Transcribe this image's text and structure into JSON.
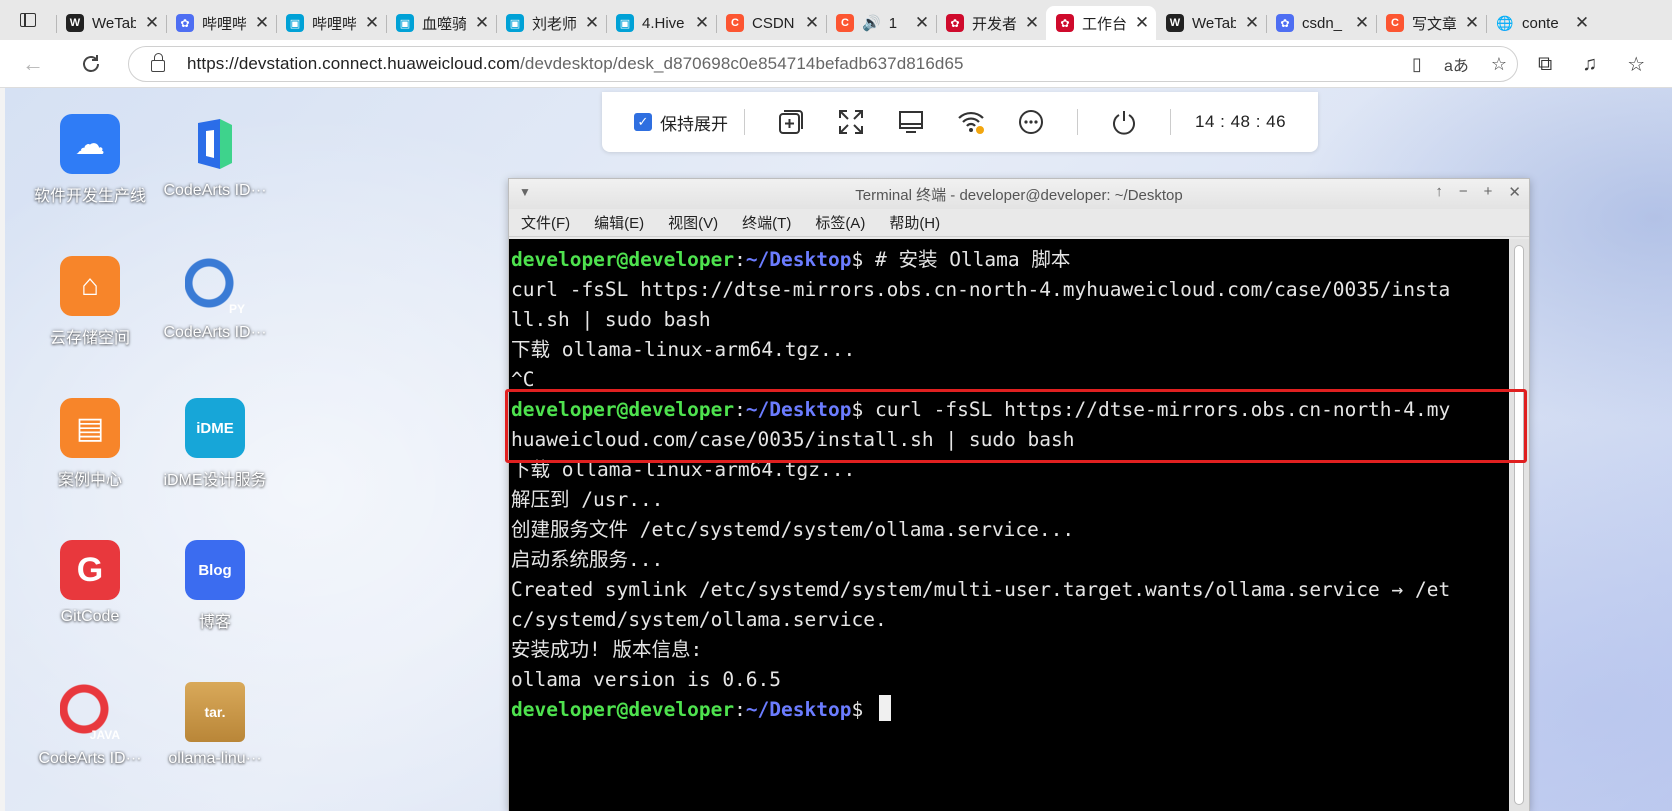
{
  "browser": {
    "tabs": [
      {
        "title": "WeTab",
        "icon": "wetab-icon",
        "color": "#222222",
        "glyph": "W"
      },
      {
        "title": "哔哩哔哩",
        "icon": "baidu-paw-icon",
        "color": "#4e6ef2",
        "glyph": "✿"
      },
      {
        "title": "哔哩哔哩",
        "icon": "bilibili-icon",
        "color": "#00a1d6",
        "glyph": "▣"
      },
      {
        "title": "血噬骑士",
        "icon": "bilibili-icon",
        "color": "#00a1d6",
        "glyph": "▣"
      },
      {
        "title": "刘老师",
        "icon": "bilibili-icon",
        "color": "#00a1d6",
        "glyph": "▣"
      },
      {
        "title": "4.Hive",
        "icon": "bilibili-icon",
        "color": "#00a1d6",
        "glyph": "▣"
      },
      {
        "title": "CSDN",
        "icon": "csdn-icon",
        "color": "#fc5531",
        "glyph": "C"
      },
      {
        "title": "1",
        "icon": "csdn-icon",
        "color": "#fc5531",
        "glyph": "C",
        "audio": "🔊"
      },
      {
        "title": "开发者",
        "icon": "huawei-icon",
        "color": "#cf0a2c",
        "glyph": "✿"
      },
      {
        "title": "工作台",
        "icon": "huawei-icon",
        "color": "#cf0a2c",
        "glyph": "✿",
        "active": true
      },
      {
        "title": "WeTab",
        "icon": "wetab-icon",
        "color": "#222222",
        "glyph": "W"
      },
      {
        "title": "csdn_",
        "icon": "baidu-paw-icon",
        "color": "#4e6ef2",
        "glyph": "✿"
      },
      {
        "title": "写文章",
        "icon": "csdn-icon",
        "color": "#fc5531",
        "glyph": "C"
      },
      {
        "title": "conte",
        "icon": "globe-icon",
        "color": "#555555",
        "glyph": "🌐"
      }
    ],
    "url_host": "https://devstation.connect.huaweicloud.com",
    "url_path": "/devdesktop/desk_d870698c0e854714befadb637d816d65"
  },
  "desktop": {
    "icons": [
      {
        "label": "软件开发生产线",
        "icon": "devcloud-icon",
        "bg": "#2f7cf6",
        "glyph": "☁"
      },
      {
        "label": "CodeArts ID···",
        "icon": "codearts-ide-icon",
        "bg": "transparent",
        "glyph": ""
      },
      {
        "label": "云存储空间",
        "icon": "cloud-storage-icon",
        "bg": "#f7852a",
        "glyph": "⌂"
      },
      {
        "label": "CodeArts ID···",
        "icon": "codearts-python-icon",
        "bg": "transparent",
        "glyph": "PY"
      },
      {
        "label": "案例中心",
        "icon": "case-center-icon",
        "bg": "#f7852a",
        "glyph": "▤"
      },
      {
        "label": "iDME设计服务",
        "icon": "idme-icon",
        "bg": "#17a6d8",
        "glyph": "iDME"
      },
      {
        "label": "GitCode",
        "icon": "gitcode-icon",
        "bg": "#e8383d",
        "glyph": "G"
      },
      {
        "label": "博客",
        "icon": "blog-icon",
        "bg": "#3b6cf0",
        "glyph": "Blog"
      },
      {
        "label": "CodeArts ID···",
        "icon": "codearts-java-icon",
        "bg": "transparent",
        "glyph": "JAVA"
      },
      {
        "label": "ollama-linu···",
        "icon": "tar-archive-icon",
        "bg": "transparent",
        "glyph": "tar."
      }
    ]
  },
  "remote_toolbar": {
    "keep_expanded_label": "保持展开",
    "clock": "14 : 48 : 46"
  },
  "terminal": {
    "title": "Terminal 终端 - developer@developer: ~/Desktop",
    "menu": [
      "文件(F)",
      "编辑(E)",
      "视图(V)",
      "终端(T)",
      "标签(A)",
      "帮助(H)"
    ],
    "prompt_user": "developer@developer",
    "prompt_path": "~/Desktop",
    "lines": [
      {
        "prompt": true,
        "text": " # 安装 Ollama 脚本"
      },
      {
        "text": "curl -fsSL https://dtse-mirrors.obs.cn-north-4.myhuaweicloud.com/case/0035/insta"
      },
      {
        "text": "ll.sh | sudo bash"
      },
      {
        "text": "下载 ollama-linux-arm64.tgz..."
      },
      {
        "text": "^C"
      },
      {
        "prompt": true,
        "text": " curl -fsSL https://dtse-mirrors.obs.cn-north-4.my"
      },
      {
        "text": "huaweicloud.com/case/0035/install.sh | sudo bash"
      },
      {
        "text": "下载 ollama-linux-arm64.tgz..."
      },
      {
        "text": "解压到 /usr..."
      },
      {
        "text": "创建服务文件 /etc/systemd/system/ollama.service..."
      },
      {
        "text": "启动系统服务..."
      },
      {
        "text": "Created symlink /etc/systemd/system/multi-user.target.wants/ollama.service → /et"
      },
      {
        "text": "c/systemd/system/ollama.service."
      },
      {
        "text": "安装成功! 版本信息:"
      },
      {
        "text": "ollama version is 0.6.5"
      },
      {
        "prompt": true,
        "text": " ",
        "cursor": true
      }
    ]
  }
}
